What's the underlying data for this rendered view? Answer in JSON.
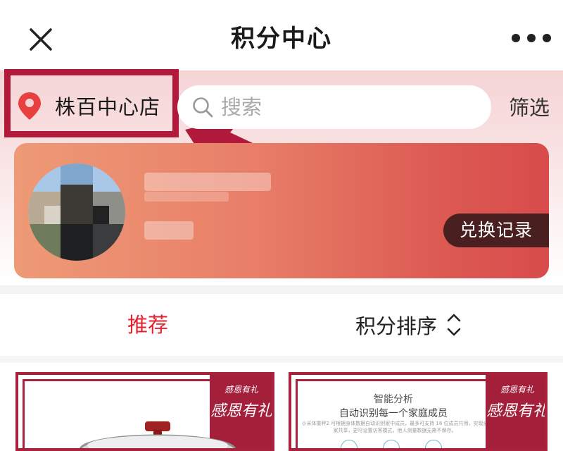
{
  "nav": {
    "title": "积分中心"
  },
  "store": {
    "name": "株百中心店"
  },
  "search": {
    "placeholder": "搜索"
  },
  "filter_label": "筛选",
  "member": {
    "redeem_label": "兑换记录"
  },
  "tabs": {
    "recommend": "推荐",
    "sort": "积分排序"
  },
  "products": [
    {
      "ribbon_line1": "感恩有礼",
      "ribbon_line2": "感恩有礼"
    },
    {
      "ribbon_line1": "感恩有礼",
      "ribbon_line2": "感恩有礼",
      "title": "智能分析",
      "subtitle": "自动识别每一个家庭成员",
      "description": "小米体重秤2 可根据身体数据自动识别家中成员，最多可支持 16 位成员共用，实现全家共享，更可设置访客模式，他人测量数据无需不保存。"
    }
  ],
  "colors": {
    "accent_red": "#e5202e",
    "annotation": "#b21a3c",
    "card_start": "#ee9a76",
    "card_end": "#d84c4c",
    "redeem_bg": "#4a1f1f",
    "ribbon": "#a31f3a"
  },
  "icons": [
    "close-icon",
    "more-icon",
    "location-pin-icon",
    "search-icon",
    "sort-updown-icon"
  ]
}
